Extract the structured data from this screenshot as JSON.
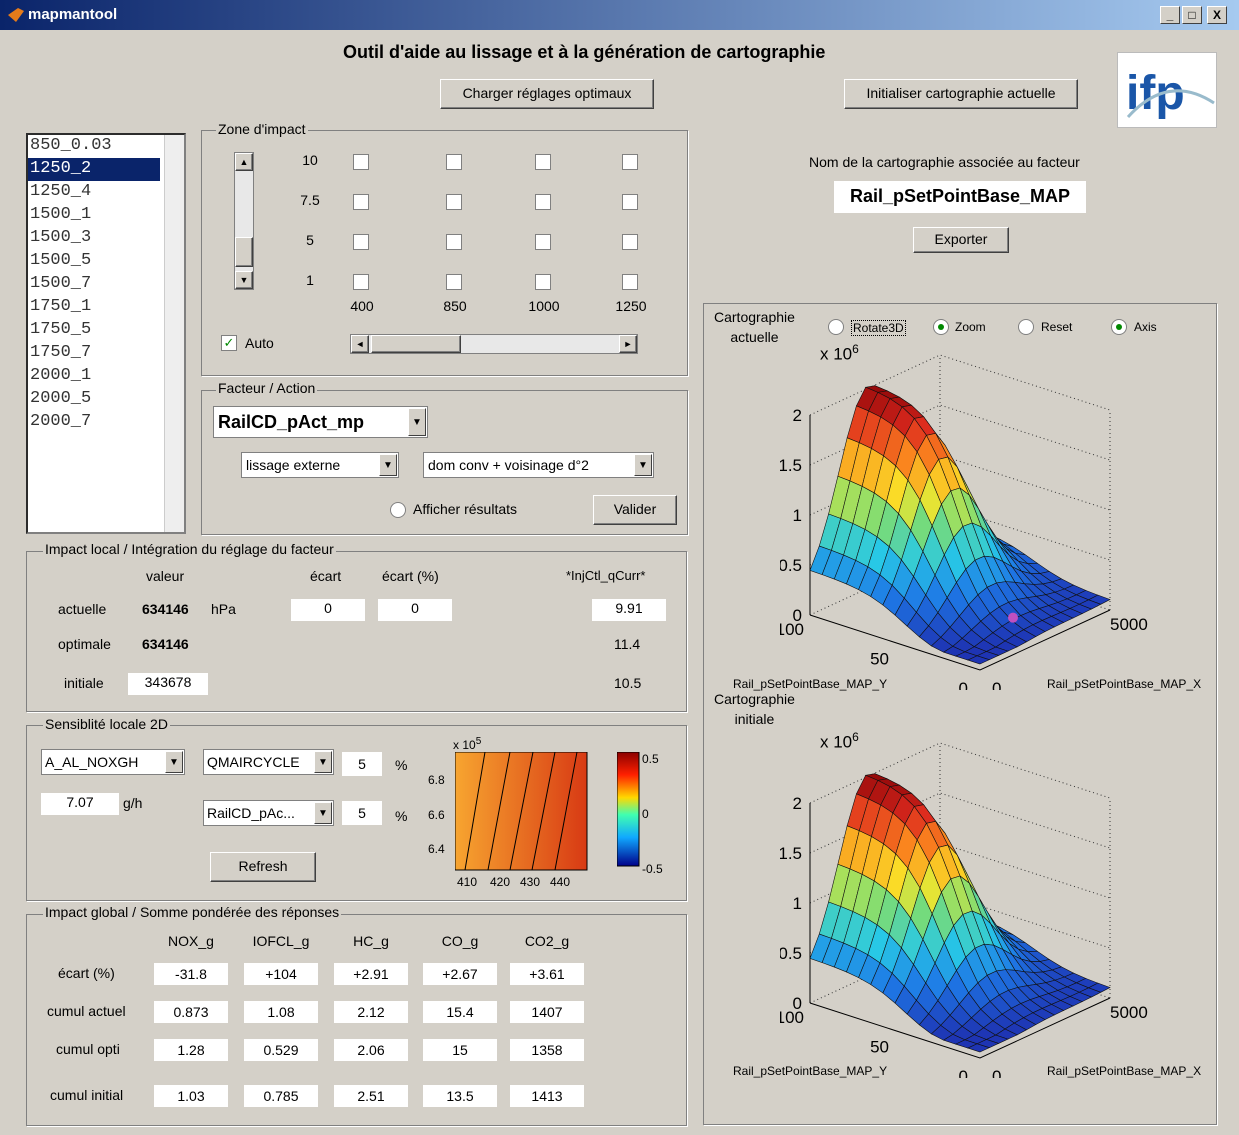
{
  "window": {
    "title": "mapmantool",
    "min": "_",
    "max": "□",
    "close": "X"
  },
  "header": {
    "title": "Outil d'aide au lissage et à la génération de cartographie",
    "load_btn": "Charger réglages optimaux",
    "init_btn": "Initialiser cartographie actuelle",
    "logo_text": "ifp"
  },
  "list": {
    "items": [
      "850_0.03",
      "1250_2",
      "1250_4",
      "1500_1",
      "1500_3",
      "1500_5",
      "1500_7",
      "1750_1",
      "1750_5",
      "1750_7",
      "2000_1",
      "2000_5",
      "2000_7"
    ],
    "selected": "1250_2"
  },
  "impact_zone": {
    "label": "Zone d'impact",
    "rows": [
      "10",
      "7.5",
      "5",
      "1"
    ],
    "cols": [
      "400",
      "850",
      "1000",
      "1250"
    ],
    "auto_label": "Auto",
    "auto_checked": true
  },
  "factor": {
    "label": "Facteur / Action",
    "factor_value": "RailCD_pAct_mp",
    "method": "lissage externe",
    "domain": "dom conv + voisinage d°2",
    "show_results": "Afficher résultats",
    "validate_btn": "Valider"
  },
  "local": {
    "label": "Impact local / Intégration du réglage du facteur",
    "headers": {
      "valeur": "valeur",
      "ecart": "écart",
      "ecart_pct": "écart (%)",
      "inj": "*InjCtl_qCurr*"
    },
    "rows": {
      "actuelle": {
        "label": "actuelle",
        "value": "634146",
        "unit": "hPa",
        "ecart": "0",
        "ecart_pct": "0",
        "inj": "9.91"
      },
      "optimale": {
        "label": "optimale",
        "value": "634146",
        "inj": "11.4"
      },
      "initiale": {
        "label": "initiale",
        "value": "343678",
        "inj": "10.5"
      }
    }
  },
  "sensitivity": {
    "label": "Sensiblité locale 2D",
    "output": "A_AL_NOXGH",
    "output_value": "7.07",
    "output_unit": "g/h",
    "var1": "QMAIRCYCLE",
    "var1_pct": "5",
    "var2": "RailCD_pAc...",
    "var2_pct": "5",
    "pct": "%",
    "refresh_btn": "Refresh",
    "ymult": "x 10",
    "yexp": "5",
    "yticks": [
      "6.8",
      "6.6",
      "6.4"
    ],
    "xticks": [
      "410",
      "420",
      "430",
      "440"
    ],
    "cbar": [
      "0.5",
      "0",
      "-0.5"
    ]
  },
  "global": {
    "label": "Impact global / Somme pondérée des réponses",
    "cols": [
      "NOX_g",
      "IOFCL_g",
      "HC_g",
      "CO_g",
      "CO2_g"
    ],
    "rows": [
      {
        "label": "écart (%)",
        "values": [
          "-31.8",
          "+104",
          "+2.91",
          "+2.67",
          "+3.61"
        ]
      },
      {
        "label": "cumul actuel",
        "values": [
          "0.873",
          "1.08",
          "2.12",
          "15.4",
          "1407"
        ]
      },
      {
        "label": "cumul opti",
        "values": [
          "1.28",
          "0.529",
          "2.06",
          "15",
          "1358"
        ]
      },
      {
        "label": "cumul initial",
        "values": [
          "1.03",
          "0.785",
          "2.51",
          "13.5",
          "1413"
        ]
      }
    ]
  },
  "map": {
    "caption": "Nom de la cartographie associée au facteur",
    "name": "Rail_pSetPointBase_MAP",
    "export_btn": "Exporter"
  },
  "plots": {
    "current_label": "Cartographie\nactuelle",
    "initial_label": "Cartographie\ninitiale",
    "radios": {
      "rotate": "Rotate3D",
      "zoom": "Zoom",
      "reset": "Reset",
      "axis": "Axis"
    },
    "zmult": "x 10",
    "zexp": "6",
    "zticks": [
      "2",
      "1.5",
      "1",
      "0.5",
      "0"
    ],
    "y_tick_100": "100",
    "y_tick_50": "50",
    "y_tick_0": "0",
    "x_tick_0": "0",
    "x_tick_5000": "5000",
    "ylabel": "Rail_pSetPointBase_MAP_Y",
    "xlabel": "Rail_pSetPointBase_MAP_X"
  }
}
